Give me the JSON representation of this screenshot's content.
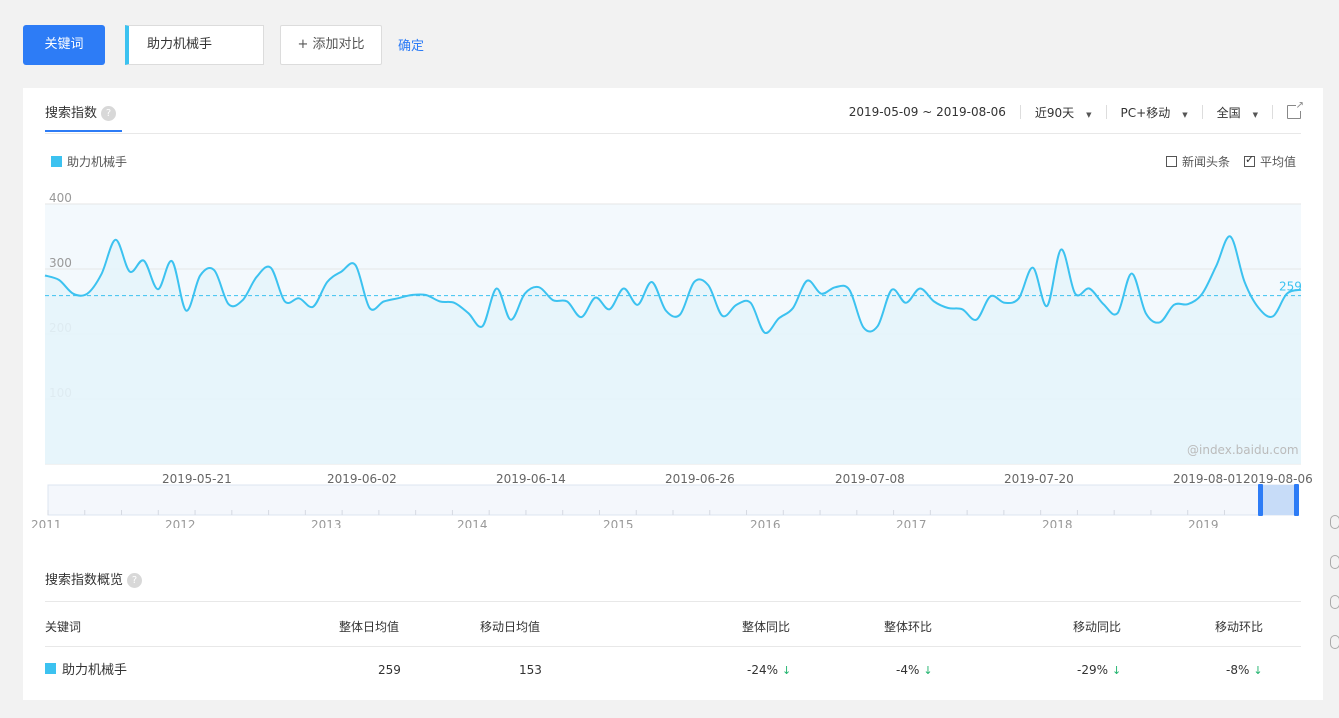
{
  "topbar": {
    "keyword_button": "关键词",
    "keyword_value": "助力机械手",
    "add_compare": "+ 添加对比",
    "confirm": "确定"
  },
  "card": {
    "tab_title": "搜索指数",
    "date_range": "2019-05-09 ~ 2019-08-06",
    "period": "近90天",
    "device": "PC+移动",
    "region": "全国",
    "legend_series": "助力机械手",
    "check_news": "新闻头条",
    "check_avg": "平均值",
    "watermark": "@index.baidu.com",
    "avg_label": "259"
  },
  "chart_data": {
    "type": "line",
    "yticks": [
      "400",
      "300",
      "200",
      "100"
    ],
    "ylim": [
      0,
      400
    ],
    "x_labels": [
      "2019-05-21",
      "2019-06-02",
      "2019-06-14",
      "2019-06-26",
      "2019-07-08",
      "2019-07-20",
      "2019-08-01",
      "2019-08-06"
    ],
    "series": [
      {
        "name": "助力机械手",
        "color": "#3cc2f0",
        "values": [
          290,
          283,
          262,
          262,
          292,
          345,
          296,
          313,
          269,
          312,
          236,
          290,
          298,
          246,
          252,
          288,
          302,
          250,
          255,
          242,
          280,
          296,
          306,
          240,
          250,
          255,
          260,
          260,
          250,
          248,
          232,
          212,
          270,
          222,
          262,
          272,
          252,
          250,
          226,
          256,
          238,
          270,
          245,
          280,
          236,
          230,
          280,
          275,
          228,
          245,
          248,
          202,
          224,
          240,
          282,
          262,
          272,
          268,
          210,
          212,
          268,
          248,
          270,
          250,
          240,
          238,
          222,
          258,
          248,
          255,
          302,
          243,
          330,
          262,
          270,
          246,
          232,
          293,
          232,
          218,
          245,
          246,
          262,
          305,
          350,
          280,
          240,
          227,
          262,
          268
        ],
        "average": 259
      }
    ],
    "range_years": [
      "2011",
      "2012",
      "2013",
      "2014",
      "2015",
      "2016",
      "2017",
      "2018",
      "2019"
    ]
  },
  "overview": {
    "title": "搜索指数概览",
    "headers": [
      "关键词",
      "整体日均值",
      "移动日均值",
      "整体同比",
      "整体环比",
      "移动同比",
      "移动环比"
    ],
    "row": {
      "keyword": "助力机械手",
      "overall_avg": "259",
      "mobile_avg": "153",
      "overall_yoy": "-24%",
      "overall_mom": "-4%",
      "mobile_yoy": "-29%",
      "mobile_mom": "-8%"
    }
  }
}
